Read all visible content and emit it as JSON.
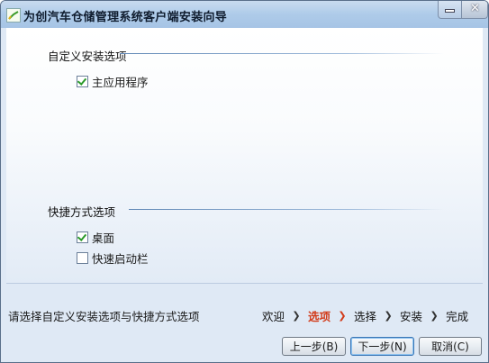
{
  "window": {
    "title": "为创汽车仓储管理系统客户端安装向导"
  },
  "custom_options": {
    "title": "自定义安装选项",
    "items": [
      {
        "label": "主应用程序",
        "checked": true
      }
    ]
  },
  "shortcut_options": {
    "title": "快捷方式选项",
    "items": [
      {
        "label": "桌面",
        "checked": true
      },
      {
        "label": "快速启动栏",
        "checked": false
      }
    ]
  },
  "status": {
    "hint": "请选择自定义安装选项与快捷方式选项"
  },
  "steps": [
    {
      "label": "欢迎",
      "active": false
    },
    {
      "label": "选项",
      "active": true
    },
    {
      "label": "选择",
      "active": false
    },
    {
      "label": "安装",
      "active": false
    },
    {
      "label": "完成",
      "active": false
    }
  ],
  "buttons": {
    "prev": "上一步(B)",
    "next": "下一步(N)",
    "cancel": "取消(C)"
  },
  "colors": {
    "active_step": "#d23b1a",
    "check_mark": "#2a9a2a",
    "titlebar": "#aecbe9"
  },
  "icons": {
    "app": "installer-app-icon",
    "minimize": "minimize-icon",
    "close": "close-icon",
    "step_arrow": "chevron-right-icon",
    "check": "checkmark-icon"
  }
}
